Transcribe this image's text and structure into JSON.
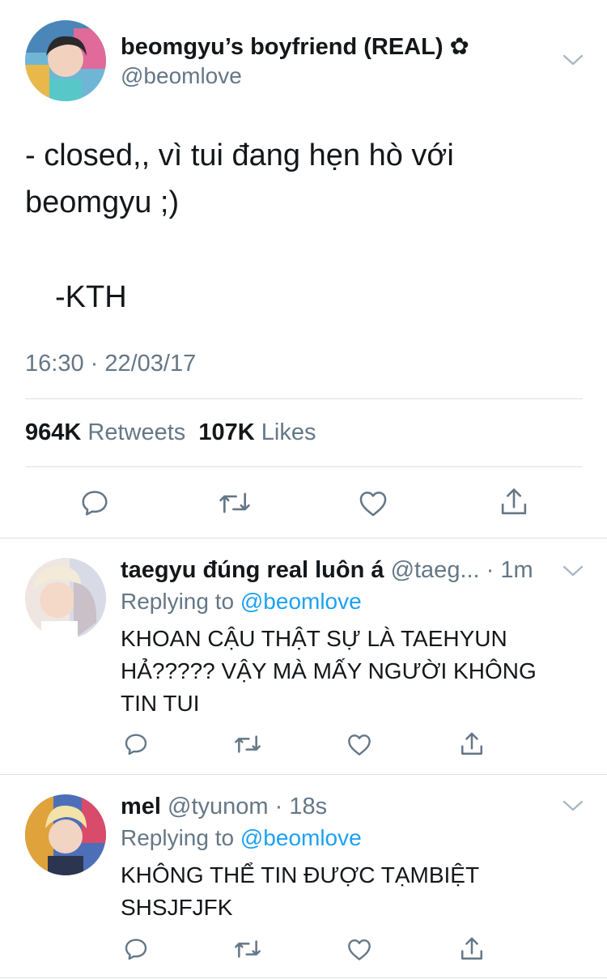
{
  "tweet": {
    "display_name": "beomgyu’s boyfriend (REAL) ✿",
    "handle": "@beomlove",
    "text": "- closed,, vì tui đang hẹn hò với beomgyu ;)",
    "signature": "-KTH",
    "timestamp": "16:30 · 22/03/17",
    "retweets_count": "964K",
    "retweets_label": "Retweets",
    "likes_count": "107K",
    "likes_label": "Likes"
  },
  "replies": [
    {
      "display_name": "taegyu đúng real luôn á",
      "handle": "@taeg...",
      "time": "· 1m",
      "replying_prefix": "Replying to",
      "replying_to": "@beomlove",
      "text": "KHOAN CẬU THẬT SỰ LÀ TAEHYUN HẢ????? VẬY MÀ MẤY NGƯỜI KHÔNG TIN TUI"
    },
    {
      "display_name": "mel",
      "handle": "@tyunom",
      "time": "· 18s",
      "replying_prefix": "Replying to",
      "replying_to": "@beomlove",
      "text": "KHÔNG THỂ TIN ĐƯỢC TẠMBIỆT SHSJFJFK"
    }
  ],
  "icons": {
    "reply": "reply-icon",
    "retweet": "retweet-icon",
    "like": "heart-icon",
    "share": "share-icon",
    "more": "chevron-down-icon"
  },
  "colors": {
    "text": "#14171a",
    "secondary": "#657786",
    "link": "#1da1f2",
    "divider": "#dcdfe2"
  }
}
